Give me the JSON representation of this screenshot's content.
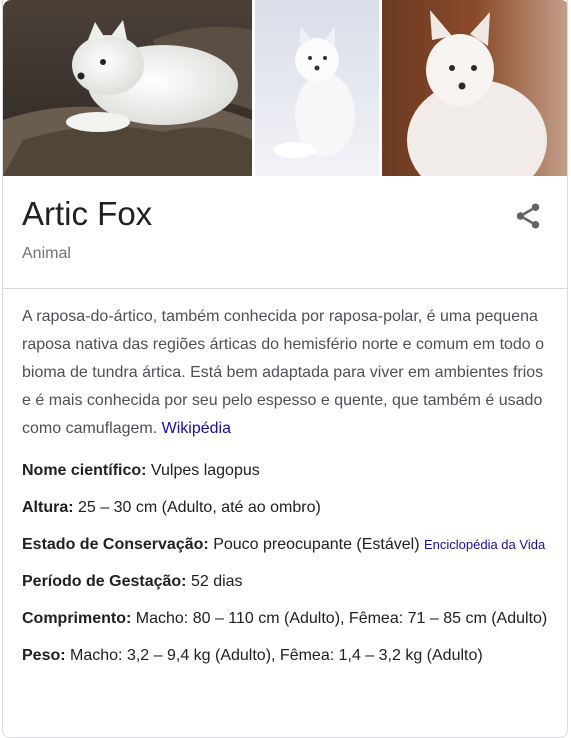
{
  "images": [
    {
      "alt": "Arctic fox lying on rocks"
    },
    {
      "alt": "Arctic fox sitting in snow"
    },
    {
      "alt": "Arctic fox close-up"
    }
  ],
  "header": {
    "title": "Artic Fox",
    "subtitle": "Animal",
    "share_icon": "share-icon"
  },
  "description": {
    "text": "A raposa-do-ártico, também conhecida por raposa-polar, é uma pequena raposa nativa das regiões árticas do hemisfério norte e comum em todo o bioma de tundra ártica. Está bem adaptada para viver em ambientes frios e é mais conhecida por seu pelo espesso e quente, que também é usado como camuflagem.",
    "source_link": "Wikipédia"
  },
  "facts": {
    "scientific_name": {
      "label": "Nome científico:",
      "value": "Vulpes lagopus"
    },
    "height": {
      "label": "Altura:",
      "value": "25 – 30 cm (Adulto, até ao ombro)"
    },
    "conservation": {
      "label": "Estado de Conservação:",
      "value": "Pouco preocupante (Estável)",
      "link": "Enciclopédia da Vida"
    },
    "gestation": {
      "label": "Período de Gestação:",
      "value": "52 dias"
    },
    "length": {
      "label": "Comprimento:",
      "value": "Macho: 80 – 110 cm (Adulto), Fêmea: 71 – 85 cm (Adulto)"
    },
    "weight": {
      "label": "Peso:",
      "value": "Macho: 3,2 – 9,4 kg (Adulto), Fêmea: 1,4 – 3,2 kg (Adulto)"
    }
  },
  "colors": {
    "link": "#1a0dab",
    "title": "#202124",
    "subtitle": "#70757a",
    "border": "#dadce0"
  }
}
